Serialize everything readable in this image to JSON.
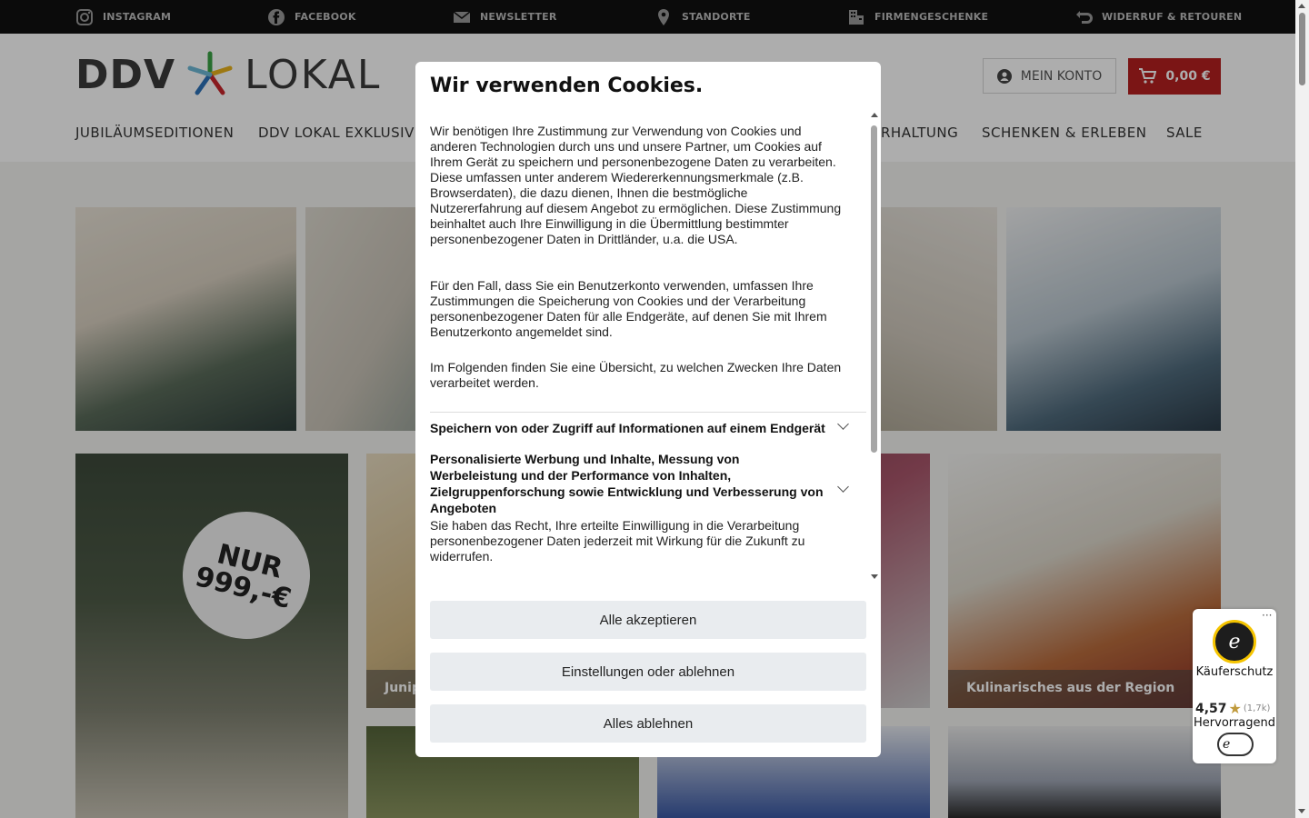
{
  "topbar": {
    "items": [
      {
        "label": "INSTAGRAM",
        "icon": "instagram-icon"
      },
      {
        "label": "FACEBOOK",
        "icon": "facebook-icon"
      },
      {
        "label": "NEWSLETTER",
        "icon": "mail-icon"
      },
      {
        "label": "STANDORTE",
        "icon": "location-pin-icon"
      },
      {
        "label": "FIRMENGESCHENKE",
        "icon": "building-icon"
      },
      {
        "label": "WIDERRUF & RETOUREN",
        "icon": "return-arrow-icon"
      }
    ]
  },
  "header": {
    "logo_left": "DDV",
    "logo_right": "LOKAL",
    "account_label": "MEIN KONTO",
    "cart_label": "0,00 €",
    "nav": [
      "JUBILÄUMSEDITIONEN",
      "DDV LOKAL EXKLUSIV",
      "RHALTUNG",
      "SCHENKEN & ERLEBEN",
      "SALE"
    ]
  },
  "tiles": {
    "badge_line1": "NUR",
    "badge_line2": "999,-€",
    "caption_2": "Junip",
    "caption_4": "Kulinarisches aus der Region"
  },
  "cookie": {
    "title": "Wir verwenden Cookies.",
    "p1": "Wir benötigen Ihre Zustimmung zur Verwendung von Cookies und anderen Technologien durch uns und unsere Partner, um Cookies auf Ihrem Gerät zu speichern und personenbezogene Daten zu verarbeiten. Diese umfassen unter anderem Wiedererkennungsmerkmale (z.B. Browserdaten), die dazu dienen, Ihnen die bestmögliche Nutzererfahrung auf diesem Angebot zu ermöglichen. Diese Zustimmung beinhaltet auch Ihre Einwilligung in die Übermittlung bestimmter personenbezogener Daten in Drittländer, u.a. die USA.",
    "p2": "Für den Fall, dass Sie ein Benutzerkonto verwenden, umfassen Ihre Zustimmungen die Speicherung von Cookies und der Verarbeitung personenbezogener Daten für alle Endgeräte, auf denen Sie mit Ihrem Benutzerkonto angemeldet sind.",
    "p3": "Im Folgenden finden Sie eine Übersicht, zu welchen Zwecken Ihre Daten verarbeitet werden.",
    "accordion1": "Speichern von oder Zugriff auf Informationen auf einem Endgerät",
    "accordion2": "Personalisierte Werbung und Inhalte, Messung von Werbeleistung und der Performance von Inhalten, Zielgruppenforschung sowie Entwicklung und Verbesserung von Angeboten",
    "p4": "Sie haben das Recht, Ihre erteilte Einwilligung in die Verarbeitung personenbezogener Daten jederzeit mit Wirkung für die Zukunft zu widerrufen.",
    "btn_accept": "Alle akzeptieren",
    "btn_settings": "Einstellungen oder ablehnen",
    "btn_reject": "Alles ablehnen"
  },
  "trusted_shops": {
    "label": "Käuferschutz",
    "rating": "4,57",
    "count": "(1,7k)",
    "grade": "Hervorragend",
    "menu": "···"
  }
}
